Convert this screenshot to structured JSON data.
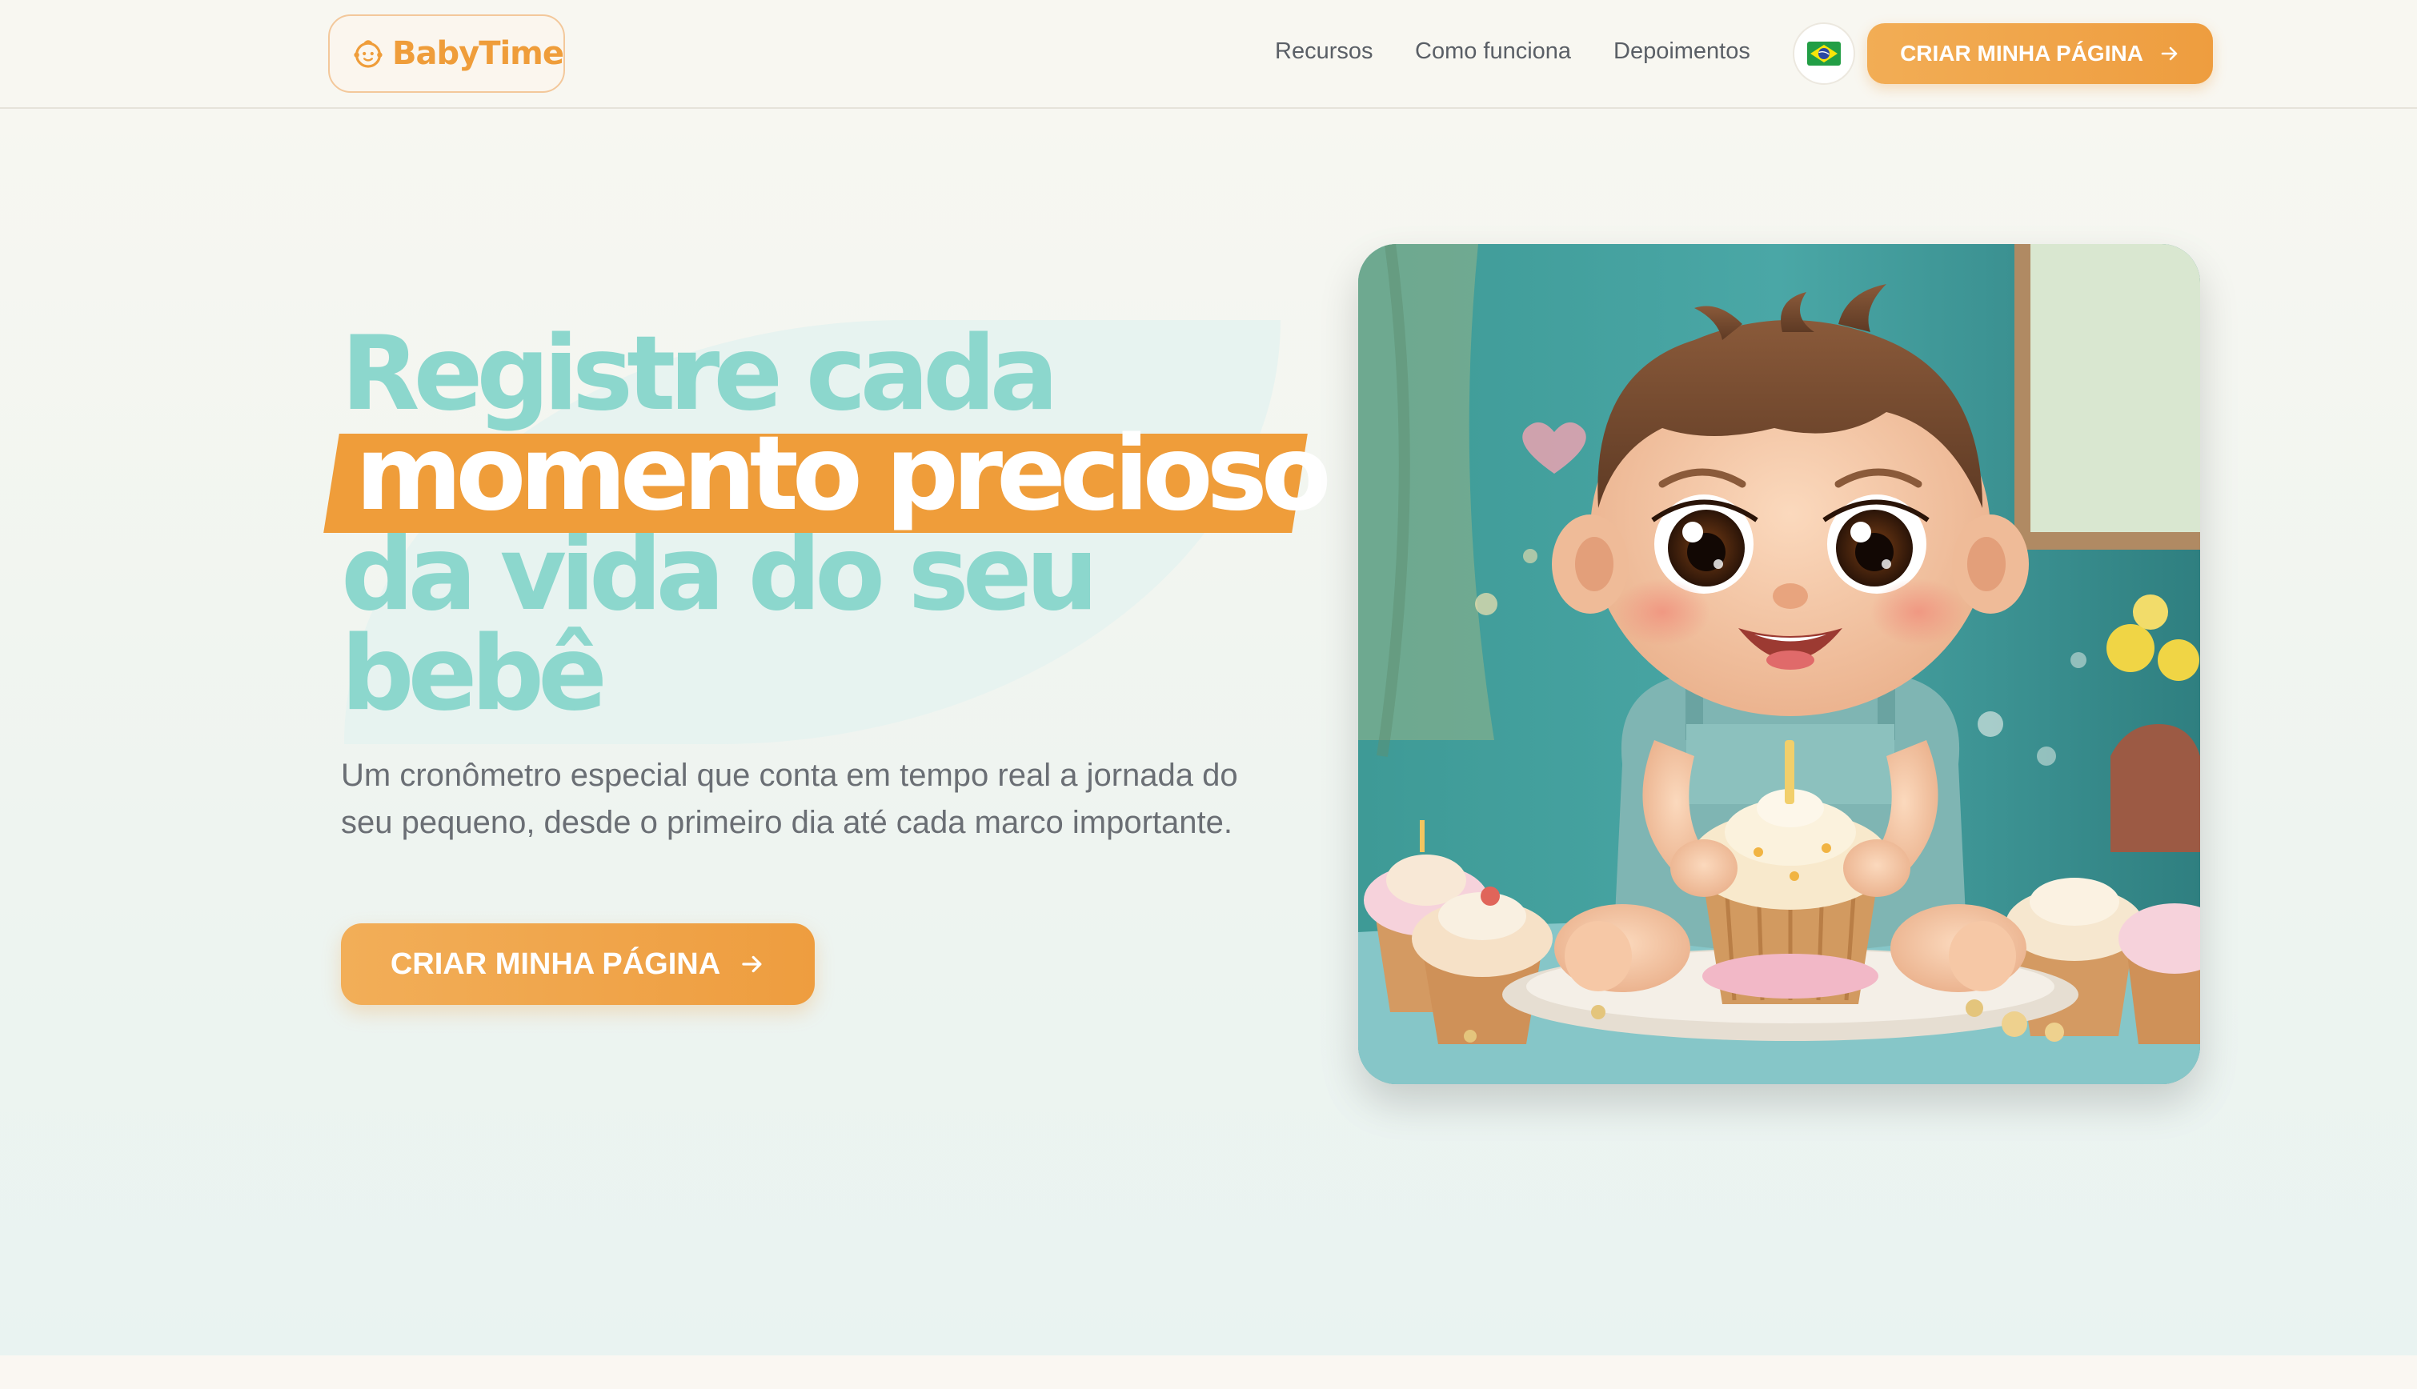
{
  "header": {
    "logo_text": "BabyTime",
    "nav": [
      {
        "label": "Recursos"
      },
      {
        "label": "Como funciona"
      },
      {
        "label": "Depoimentos"
      }
    ],
    "language_flag_icon": "brazil-flag-icon",
    "cta_label": "CRIAR MINHA PÁGINA"
  },
  "hero": {
    "headline_line1": "Registre cada",
    "headline_highlight": "momento precioso",
    "headline_line3": "da vida do seu",
    "headline_line4": "bebê",
    "subtitle": "Um cronômetro especial que conta em tempo real a jornada do seu pequeno, desde o primeiro dia até cada marco importante.",
    "cta_label": "CRIAR MINHA PÁGINA",
    "image_subject": "illustrated baby with cupcakes"
  },
  "colors": {
    "accent_orange": "#ef9d3a",
    "headline_teal": "#8cd7cd",
    "text_gray": "#6a6e74",
    "background": "#f8f7f1"
  },
  "icons": [
    "baby-face-icon",
    "arrow-right-icon",
    "brazil-flag-icon"
  ]
}
